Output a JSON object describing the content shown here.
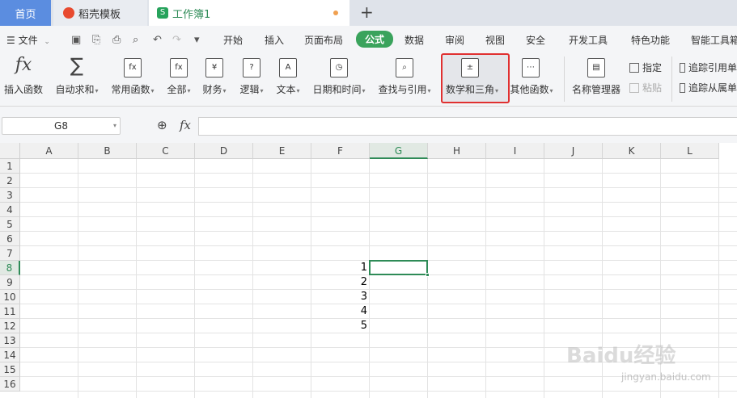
{
  "tabs": {
    "home": "首页",
    "docer": "稻壳模板",
    "doc_icon": "S",
    "doc": "工作簿1",
    "new_tab": "+"
  },
  "menubar": {
    "file": "文件",
    "tabs": [
      "开始",
      "插入",
      "页面布局",
      "公式",
      "数据",
      "审阅",
      "视图",
      "安全",
      "开发工具",
      "特色功能",
      "智能工具箱"
    ],
    "active_tab": "公式"
  },
  "ribbon": {
    "insert_function": "插入函数",
    "autosum": "自动求和",
    "common": "常用函数",
    "all": "全部",
    "finance": "财务",
    "logic": "逻辑",
    "text": "文本",
    "datetime": "日期和时间",
    "lookup": "查找与引用",
    "math_trig": "数学和三角",
    "other": "其他函数",
    "name_manager": "名称管理器",
    "define": "指定",
    "paste": "粘贴",
    "trace_precedents": "追踪引用单",
    "trace_dependents": "追踪从属单",
    "fx_glyph": "fx",
    "sigma_glyph": "∑"
  },
  "formula_bar": {
    "name_box": "G8",
    "fx": "fx",
    "formula": ""
  },
  "grid": {
    "columns": [
      "A",
      "B",
      "C",
      "D",
      "E",
      "F",
      "G",
      "H",
      "I",
      "J",
      "K",
      "L"
    ],
    "rows": [
      "1",
      "2",
      "3",
      "4",
      "5",
      "6",
      "7",
      "8",
      "9",
      "10",
      "11",
      "12",
      "13",
      "14",
      "15",
      "16"
    ],
    "active_column": "G",
    "active_row": "8",
    "values": [
      {
        "cell": "F8",
        "value": "1"
      },
      {
        "cell": "F9",
        "value": "2"
      },
      {
        "cell": "F10",
        "value": "3"
      },
      {
        "cell": "F11",
        "value": "4"
      },
      {
        "cell": "F12",
        "value": "5"
      }
    ]
  },
  "watermark": {
    "text": "Baidu经验",
    "sub": "jingyan.baidu.com"
  },
  "colors": {
    "accent": "#3aa35c",
    "highlight": "#e03030"
  }
}
